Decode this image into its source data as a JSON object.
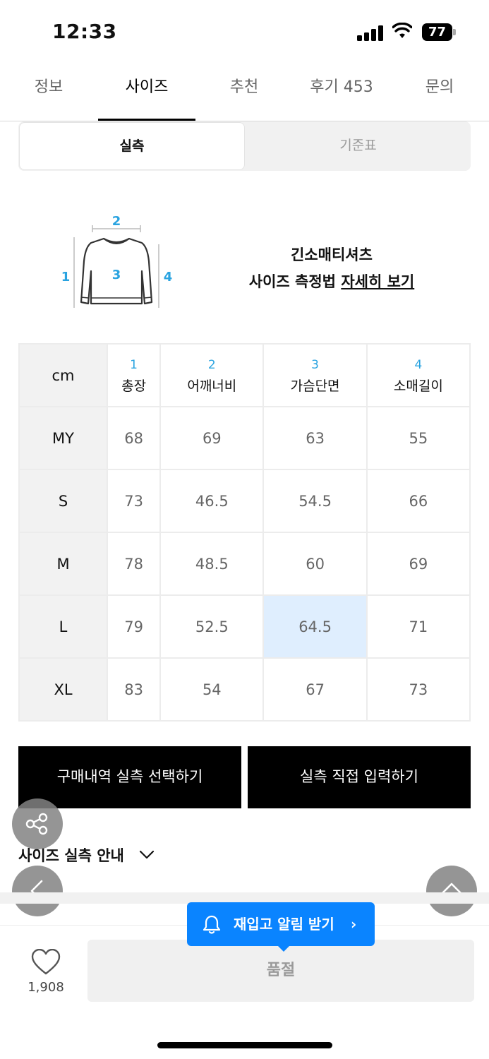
{
  "status_bar": {
    "time": "12:33",
    "battery": "77"
  },
  "tabs": [
    {
      "label": "정보"
    },
    {
      "label": "사이즈"
    },
    {
      "label": "추천"
    },
    {
      "label": "후기 453"
    },
    {
      "label": "문의"
    }
  ],
  "segment": {
    "active": "실측",
    "inactive": "기준표"
  },
  "diagram": {
    "labels": [
      "1",
      "2",
      "3",
      "4"
    ]
  },
  "measure_info": {
    "line1": "긴소매티셔츠",
    "line2_prefix": "사이즈 측정법 ",
    "line2_link": "자세히 보기"
  },
  "size_table": {
    "unit": "cm",
    "columns": [
      {
        "num": "1",
        "name": "총장"
      },
      {
        "num": "2",
        "name": "어깨너비"
      },
      {
        "num": "3",
        "name": "가슴단면"
      },
      {
        "num": "4",
        "name": "소매길이"
      }
    ],
    "rows": [
      {
        "size": "MY",
        "values": [
          "68",
          "69",
          "63",
          "55"
        ]
      },
      {
        "size": "S",
        "values": [
          "73",
          "46.5",
          "54.5",
          "66"
        ]
      },
      {
        "size": "M",
        "values": [
          "78",
          "48.5",
          "60",
          "69"
        ]
      },
      {
        "size": "L",
        "values": [
          "79",
          "52.5",
          "64.5",
          "71"
        ]
      },
      {
        "size": "XL",
        "values": [
          "83",
          "54",
          "67",
          "73"
        ]
      }
    ]
  },
  "buttons": {
    "purchase_history": "구매내역 실측 선택하기",
    "manual_input": "실측 직접 입력하기"
  },
  "guide": {
    "label": "사이즈 실측 안내"
  },
  "alarm": {
    "label": "재입고 알림 받기",
    "arrow": "›"
  },
  "bottom": {
    "like_count": "1,908",
    "soldout_label": "품절"
  },
  "colors": {
    "accent_blue": "#0a84ff",
    "diagram_number": "#29a3e0",
    "highlight_cell": "#dfeefe"
  },
  "icons": [
    "share-icon",
    "back-icon",
    "scroll-top-icon",
    "heart-icon",
    "bell-icon",
    "chevron-down-icon"
  ]
}
